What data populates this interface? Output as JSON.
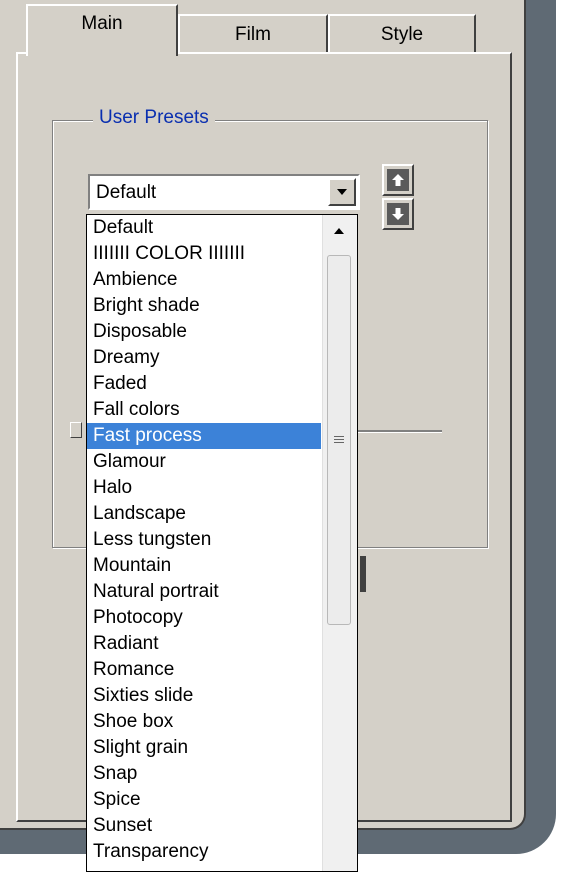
{
  "tabs": [
    {
      "label": "Main",
      "active": true
    },
    {
      "label": "Film",
      "active": false
    },
    {
      "label": "Style",
      "active": false
    }
  ],
  "group": {
    "label": "User Presets"
  },
  "combo": {
    "value": "Default"
  },
  "presets": [
    "Default",
    "IIIIIII COLOR IIIIIII",
    "Ambience",
    "Bright shade",
    "Disposable",
    "Dreamy",
    "Faded",
    "Fall colors",
    "Fast process",
    "Glamour",
    "Halo",
    "Landscape",
    "Less tungsten",
    "Mountain",
    "Natural portrait",
    "Photocopy",
    "Radiant",
    "Romance",
    "Sixties slide",
    "Shoe box",
    "Slight grain",
    "Snap",
    "Spice",
    "Sunset",
    "Transparency"
  ],
  "selected_preset": "Fast process",
  "icons": {
    "move_up": "arrow-up-icon",
    "move_down": "arrow-down-icon",
    "combo_dropdown": "chevron-down-icon",
    "scroll_up": "scroll-up-arrow-icon",
    "scroll_grip": "grip-icon"
  },
  "colors": {
    "selection": "#3c82d8",
    "group_label": "#0a2fb0",
    "frame": "#5f6a74"
  }
}
